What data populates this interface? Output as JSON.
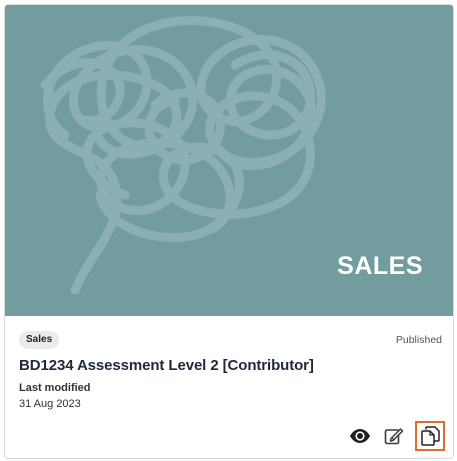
{
  "card": {
    "cover": {
      "label": "SALES",
      "background": "#739c9f",
      "scribble_color": "#8fb4b8"
    },
    "tag": "Sales",
    "status": "Published",
    "title": "BD1234 Assessment Level 2 [Contributor]",
    "modified_label": "Last modified",
    "modified_date": "31 Aug 2023",
    "actions": [
      {
        "icon": "eye-icon"
      },
      {
        "icon": "edit-icon"
      },
      {
        "icon": "copy-icon",
        "highlight": "#e4692e"
      }
    ]
  }
}
